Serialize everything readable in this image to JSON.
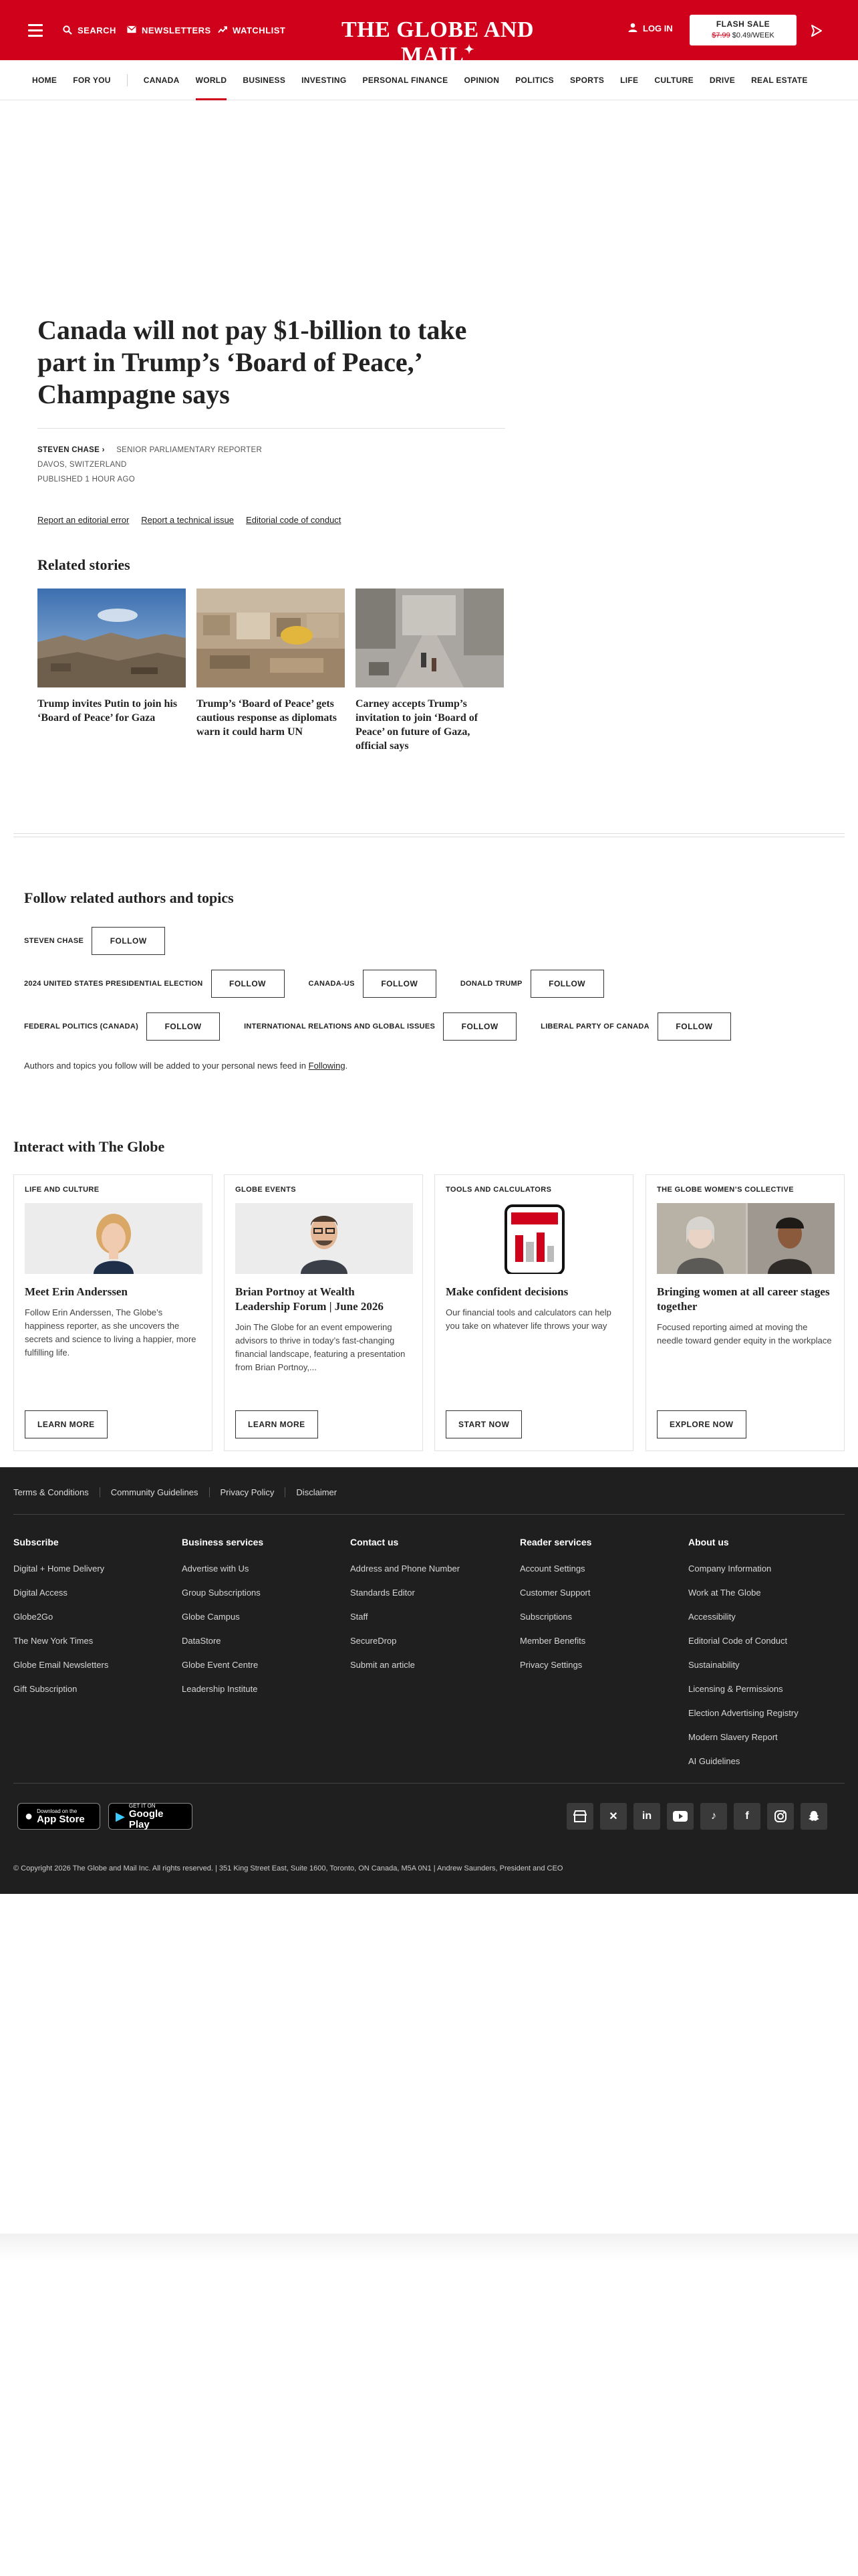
{
  "header": {
    "search": "SEARCH",
    "newsletters": "NEWSLETTERS",
    "watchlist": "WATCHLIST",
    "brand": "THE GLOBE AND MAIL",
    "login": "LOG IN",
    "flash_title": "FLASH SALE",
    "flash_old": "$7.99",
    "flash_new": " $0.49/WEEK"
  },
  "nav": {
    "left": [
      "HOME",
      "FOR YOU"
    ],
    "items": [
      "CANADA",
      "WORLD",
      "BUSINESS",
      "INVESTING",
      "PERSONAL FINANCE",
      "OPINION",
      "POLITICS",
      "SPORTS",
      "LIFE",
      "CULTURE",
      "DRIVE",
      "REAL ESTATE"
    ],
    "active": "WORLD"
  },
  "article": {
    "headline": "Canada will not pay $1-billion to take part in Trump’s ‘Board of Peace,’ Champagne says",
    "author": "STEVEN CHASE",
    "role": "SENIOR PARLIAMENTARY REPORTER",
    "location": "DAVOS, SWITZERLAND",
    "published": "PUBLISHED 1 HOUR AGO",
    "report_links": [
      "Report an editorial error",
      "Report a technical issue",
      "Editorial code of conduct"
    ]
  },
  "related": {
    "title": "Related stories",
    "items": [
      "Trump invites Putin to join his ‘Board of Peace’ for Gaza",
      "Trump’s ‘Board of Peace’ gets cautious response as diplomats warn it could harm UN",
      "Carney accepts Trump’s invitation to join ‘Board of Peace’ on future of Gaza, official says"
    ]
  },
  "follow": {
    "title": "Follow related authors and topics",
    "button": "FOLLOW",
    "rows": [
      [
        "STEVEN CHASE"
      ],
      [
        "2024 UNITED STATES PRESIDENTIAL ELECTION",
        "CANADA-US",
        "DONALD TRUMP"
      ],
      [
        "FEDERAL POLITICS (CANADA)",
        "INTERNATIONAL RELATIONS AND GLOBAL ISSUES",
        "LIBERAL PARTY OF CANADA"
      ]
    ],
    "note_prefix": "Authors and topics you follow will be added to your personal news feed in ",
    "note_link": "Following",
    "note_suffix": "."
  },
  "interact": {
    "title": "Interact with The Globe",
    "cards": [
      {
        "kicker": "LIFE AND CULTURE",
        "title": "Meet Erin Anderssen",
        "desc": "Follow Erin Anderssen, The Globe’s happiness reporter, as she uncovers the secrets and science to living a happier, more fulfilling life.",
        "button": "LEARN MORE"
      },
      {
        "kicker": "GLOBE EVENTS",
        "title": "Brian Portnoy at Wealth Leadership Forum | June 2026",
        "desc": "Join The Globe for an event empowering advisors to thrive in today’s fast-changing financial landscape, featuring a presentation from Brian Portnoy,...",
        "button": "LEARN MORE"
      },
      {
        "kicker": "TOOLS AND CALCULATORS",
        "title": "Make confident decisions",
        "desc": "Our financial tools and calculators can help you take on whatever life throws your way",
        "button": "START NOW"
      },
      {
        "kicker": "THE GLOBE WOMEN’S COLLECTIVE",
        "title": "Bringing women at all career stages together",
        "desc": "Focused reporting aimed at moving the needle toward gender equity in the workplace",
        "button": "EXPLORE NOW"
      }
    ]
  },
  "footer": {
    "top_links": [
      "Terms & Conditions",
      "Community Guidelines",
      "Privacy Policy",
      "Disclaimer"
    ],
    "columns": [
      {
        "title": "Subscribe",
        "items": [
          "Digital + Home Delivery",
          "Digital Access",
          "Globe2Go",
          "The New York Times",
          "Globe Email Newsletters",
          "Gift Subscription"
        ]
      },
      {
        "title": "Business services",
        "items": [
          "Advertise with Us",
          "Group Subscriptions",
          "Globe Campus",
          "DataStore",
          "Globe Event Centre",
          "Leadership Institute"
        ]
      },
      {
        "title": "Contact us",
        "items": [
          "Address and Phone Number",
          "Standards Editor",
          "Staff",
          "SecureDrop",
          "Submit an article"
        ]
      },
      {
        "title": "Reader services",
        "items": [
          "Account Settings",
          "Customer Support",
          "Subscriptions",
          "Member Benefits",
          "Privacy Settings"
        ]
      },
      {
        "title": "About us",
        "items": [
          "Company Information",
          "Work at The Globe",
          "Accessibility",
          "Editorial Code of Conduct",
          "Sustainability",
          "Licensing & Permissions",
          "Election Advertising Registry",
          "Modern Slavery Report",
          "AI Guidelines"
        ]
      }
    ],
    "appstore_small": "Download on the",
    "appstore_large": "App Store",
    "googleplay_small": "GET IT ON",
    "googleplay_large": "Google Play",
    "copyright": "© Copyright 2026 The Globe and Mail Inc. All rights reserved.  |  351 King Street East, Suite 1600, Toronto, ON Canada, M5A 0N1  |  Andrew Saunders, President and CEO"
  }
}
